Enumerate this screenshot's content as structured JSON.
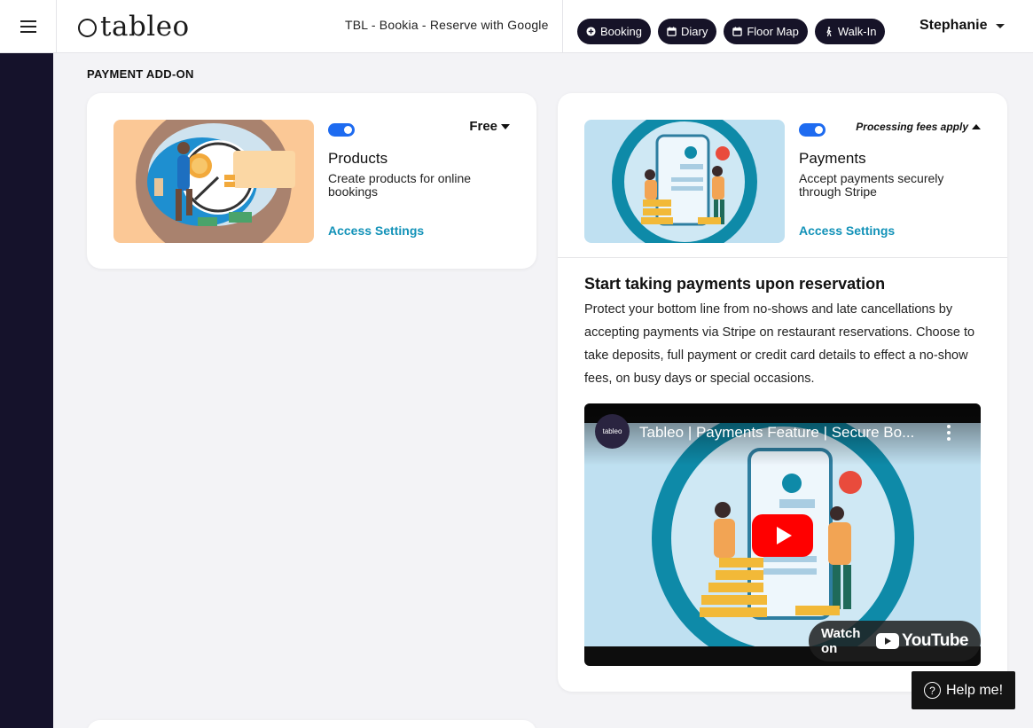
{
  "header": {
    "logo_text": "tableo",
    "venue": "TBL - Bookia - Reserve with Google",
    "nav": [
      {
        "label": "Booking",
        "icon": "plus-circle-icon"
      },
      {
        "label": "Diary",
        "icon": "calendar-icon"
      },
      {
        "label": "Floor Map",
        "icon": "calendar-icon"
      },
      {
        "label": "Walk-In",
        "icon": "walking-person-icon"
      }
    ],
    "user": "Stephanie"
  },
  "section_title": "PAYMENT ADD-ON",
  "products": {
    "price": "Free",
    "name": "Products",
    "description": "Create products for online bookings",
    "link": "Access Settings",
    "enabled": true
  },
  "payments": {
    "price": "Processing fees apply",
    "name": "Payments",
    "description": "Accept payments securely through Stripe",
    "link": "Access Settings",
    "enabled": true,
    "heading": "Start taking payments upon reservation",
    "body": "Protect your bottom line from no-shows and late cancellations by accepting payments via Stripe on restaurant reservations. Choose to take deposits, full payment or credit card details to effect a no-show fees, on busy days or special occasions.",
    "video": {
      "channel": "tableo",
      "title": "Tableo | Payments Feature | Secure Bo...",
      "watch_label": "Watch on",
      "platform": "YouTube"
    }
  },
  "help": "Help me!",
  "colors": {
    "accent": "#1e6bf0",
    "link": "#1292b8",
    "dark": "#15122b"
  }
}
